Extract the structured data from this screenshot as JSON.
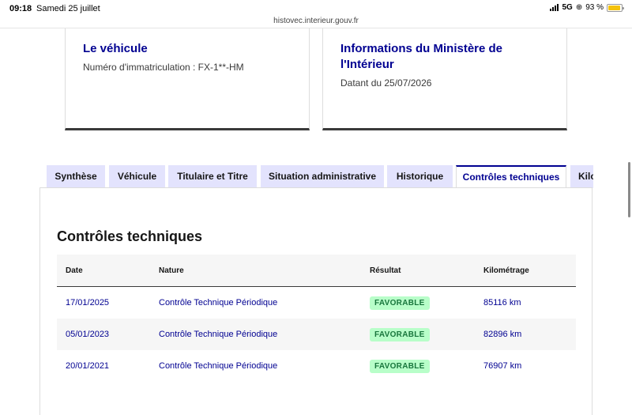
{
  "status_bar": {
    "time": "09:18",
    "date": "Samedi 25 juillet",
    "network": "5G",
    "battery": "93 %",
    "url": "histovec.interieur.gouv.fr"
  },
  "vehicle_card": {
    "title": "Le véhicule",
    "description": "Numéro d'immatriculation : FX-1**-HM"
  },
  "ministry_card": {
    "title": "Informations du Ministère de l'Intérieur",
    "description": "Datant du 25/07/2026"
  },
  "tabs": [
    {
      "label": "Synthèse"
    },
    {
      "label": "Véhicule"
    },
    {
      "label": "Titulaire et Titre"
    },
    {
      "label": "Situation administrative"
    },
    {
      "label": "Historique"
    },
    {
      "label": "Contrôles techniques",
      "active": true
    },
    {
      "label": "Kilométrage"
    }
  ],
  "section": {
    "title": "Contrôles techniques"
  },
  "table": {
    "headers": [
      "Date",
      "Nature",
      "Résultat",
      "Kilométrage"
    ],
    "rows": [
      {
        "date": "17/01/2025",
        "nature": "Contrôle Technique Périodique",
        "result": "FAVORABLE",
        "km": "85116 km"
      },
      {
        "date": "05/01/2023",
        "nature": "Contrôle Technique Périodique",
        "result": "FAVORABLE",
        "km": "82896 km"
      },
      {
        "date": "20/01/2021",
        "nature": "Contrôle Technique Périodique",
        "result": "FAVORABLE",
        "km": "76907 km"
      }
    ]
  },
  "colors": {
    "primary": "#000091",
    "tab_bg": "#e3e3fd",
    "badge_bg": "#b8fec9",
    "badge_text": "#18753c"
  }
}
